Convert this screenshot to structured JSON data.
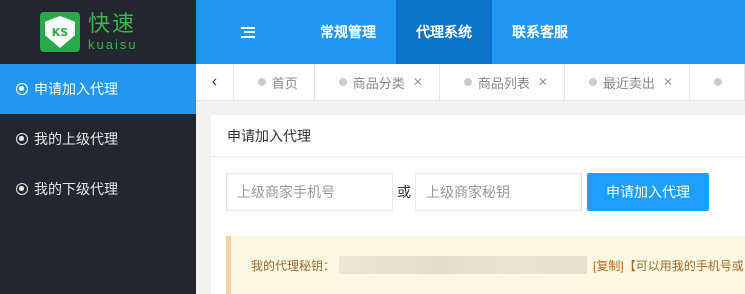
{
  "brand": {
    "logo_badge": "KS",
    "name_cn": "快速",
    "name_en": "kuaisu"
  },
  "header": {
    "menu_icon": "hamburger-icon",
    "nav": [
      {
        "label": "常规管理",
        "active": false
      },
      {
        "label": "代理系统",
        "active": true
      },
      {
        "label": "联系客服",
        "active": false
      }
    ]
  },
  "sidebar": {
    "items": [
      {
        "label": "申请加入代理",
        "active": true
      },
      {
        "label": "我的上级代理",
        "active": false
      },
      {
        "label": "我的下级代理",
        "active": false
      }
    ]
  },
  "tabs": {
    "items": [
      {
        "label": "首页",
        "closable": false
      },
      {
        "label": "商品分类",
        "closable": true
      },
      {
        "label": "商品列表",
        "closable": true
      },
      {
        "label": "最近卖出",
        "closable": true
      }
    ]
  },
  "main": {
    "title": "申请加入代理",
    "phone_placeholder": "上级商家手机号",
    "or_label": "或",
    "secret_placeholder": "上级商家秘钥",
    "apply_button": "申请加入代理",
    "notice_label": "我的代理秘钥：",
    "copy_link": "[复制]",
    "notice_tail": "【可以用我的手机号或"
  },
  "colors": {
    "primary": "#2196f3",
    "sidebar_bg": "#23262e",
    "button": "#1e9fff",
    "notice_bg": "#fdf8e4"
  }
}
